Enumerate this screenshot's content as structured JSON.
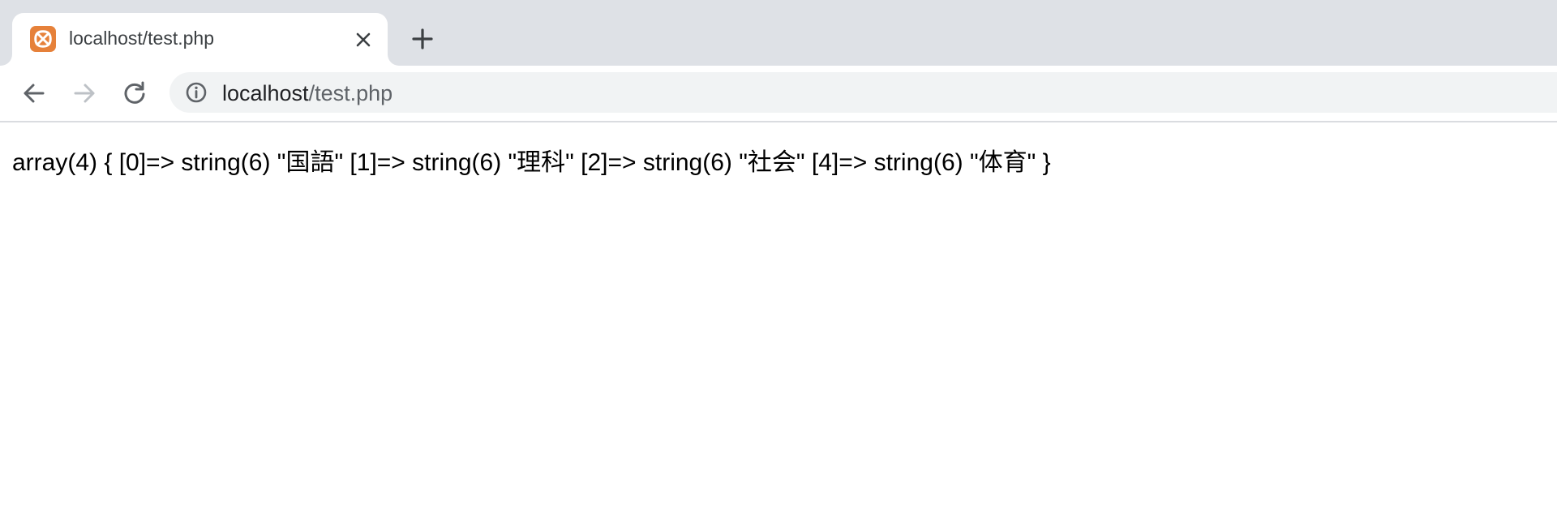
{
  "browser": {
    "tab": {
      "title": "localhost/test.php",
      "favicon": "xampp-icon"
    },
    "new_tab": "plus-icon",
    "toolbar": {
      "back": "arrow-left-icon",
      "forward": "arrow-right-icon",
      "reload": "reload-icon"
    },
    "address_bar": {
      "host": "localhost",
      "path": "/test.php",
      "security_icon": "info-icon"
    }
  },
  "page": {
    "output": "array(4) { [0]=> string(6) \"国語\" [1]=> string(6) \"理科\" [2]=> string(6) \"社会\" [4]=> string(6) \"体育\" }"
  },
  "colors": {
    "tab_strip": "#dee1e6",
    "favicon": "#e6813a",
    "omnibox": "#f1f3f4",
    "url_host": "#202124",
    "url_path": "#5f6368"
  }
}
